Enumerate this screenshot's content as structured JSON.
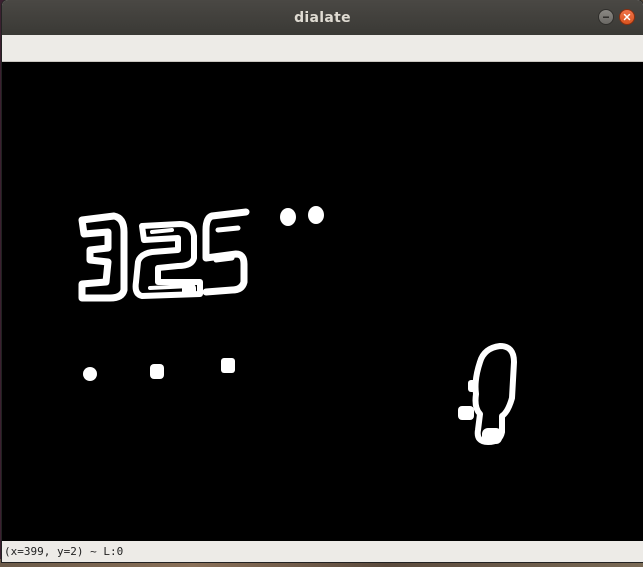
{
  "window": {
    "title": "dialate"
  },
  "controls": {
    "minimize_icon": "minimize-icon",
    "close_icon": "close-icon"
  },
  "statusbar": {
    "text": "(x=399, y=2) ~ L:0"
  },
  "colors": {
    "titlebar": "#3a3935",
    "canvas_background": "#000000",
    "foreground_pixels": "#ffffff",
    "close_button": "#e0591f"
  }
}
